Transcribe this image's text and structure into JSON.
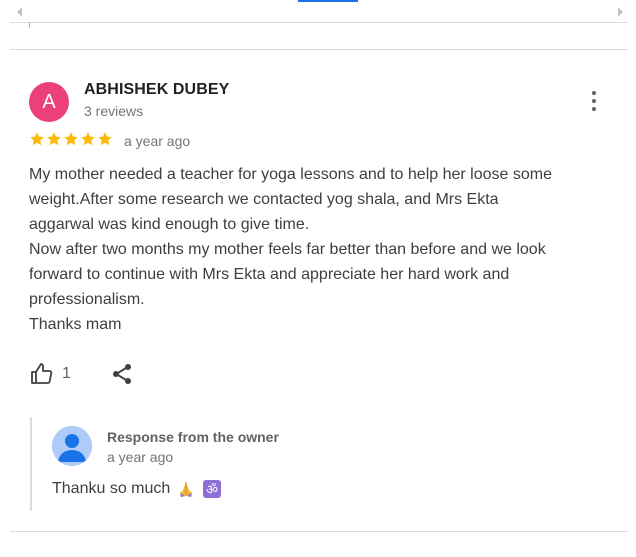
{
  "review": {
    "author_initial": "A",
    "author_name": "ABHISHEK DUBEY",
    "review_count": "3 reviews",
    "rating": 5,
    "rating_max": 5,
    "time": "a year ago",
    "text_lines": [
      "My mother needed a teacher for yoga lessons and to help her loose some",
      "weight.After some research we contacted yog shala, and Mrs Ekta",
      "aggarwal was kind enough to give time.",
      "Now after two months my mother feels far better than before and we look",
      "forward to continue with Mrs Ekta and appreciate her hard work and",
      "professionalism.",
      "Thanks mam"
    ],
    "like_count": "1"
  },
  "owner_response": {
    "title": "Response from the owner",
    "time": "a year ago",
    "text": "Thanku so much"
  },
  "colors": {
    "avatar_bg": "#ec407a",
    "star": "#fbbc04",
    "accent": "#1a73e8"
  },
  "icons": {
    "menu": "more-vert-icon",
    "like": "thumb-up-icon",
    "share": "share-icon",
    "prayer": "folded-hands-emoji",
    "om": "om-symbol-emoji"
  }
}
